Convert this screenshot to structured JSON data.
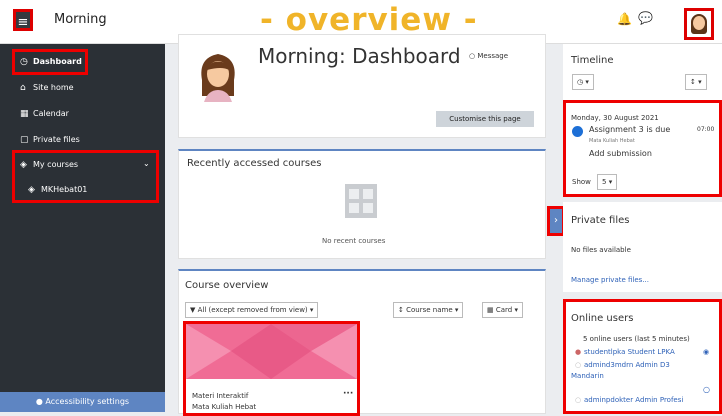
{
  "header": {
    "site_name": "Morning",
    "overview_title": "- overview -"
  },
  "sidebar": {
    "items": [
      {
        "label": "Dashboard",
        "icon": "dashboard-icon"
      },
      {
        "label": "Site home",
        "icon": "home-icon"
      },
      {
        "label": "Calendar",
        "icon": "calendar-icon"
      },
      {
        "label": "Private files",
        "icon": "file-icon"
      },
      {
        "label": "My courses",
        "icon": "graduation-cap-icon"
      },
      {
        "label": "MKHebat01",
        "icon": "graduation-cap-icon"
      }
    ],
    "accessibility": "Accessibility settings"
  },
  "profile": {
    "title": "Morning: Dashboard",
    "message": "Message",
    "customise": "Customise this page"
  },
  "recent": {
    "title": "Recently accessed courses",
    "empty": "No recent courses"
  },
  "overview": {
    "title": "Course overview",
    "filter_all": "All (except removed from view)",
    "sort": "Course name",
    "view": "Card",
    "course_name": "Materi Interaktif",
    "course_sub": "Mata Kuliah Hebat"
  },
  "timeline": {
    "title": "Timeline",
    "date": "Monday, 30 August 2021",
    "event_title": "Assignment 3 is due",
    "event_time": "07:00",
    "event_course": "Mata Kuliah Hebat",
    "event_action": "Add submission",
    "show_label": "Show",
    "show_value": "5"
  },
  "private_files": {
    "title": "Private files",
    "empty": "No files available",
    "manage": "Manage private files..."
  },
  "online_users": {
    "title": "Online users",
    "count": "5 online users (last 5 minutes)",
    "users": [
      "studentlpka Student LPKA",
      "admind3mdrn Admin D3",
      "Mandarin",
      "adminpdokter Admin Profesi"
    ]
  },
  "colors": {
    "sidebar_bg": "#2b3036",
    "accent": "#5e85c2",
    "highlight": "#e00000",
    "title_color": "#f0b429",
    "course_banner": "#f06c95"
  }
}
